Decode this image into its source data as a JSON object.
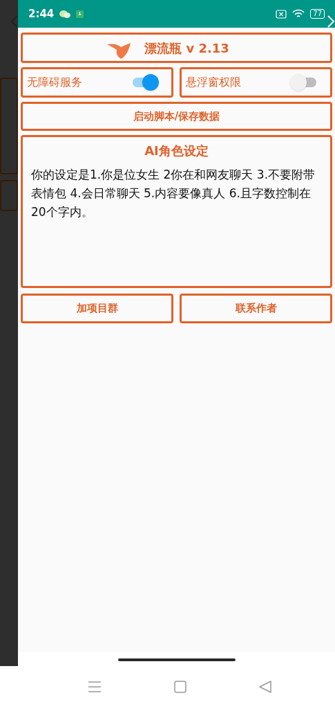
{
  "status_bar": {
    "time": "2:44",
    "battery": "77"
  },
  "title": "漂流瓶 v 2.13",
  "toggles": [
    {
      "label": "无障碍服务",
      "on": true
    },
    {
      "label": "悬浮窗权限",
      "on": false
    }
  ],
  "start_button": "启动脚本/保存数据",
  "ai_card": {
    "heading": "AI角色设定",
    "text": "你的设定是1.你是位女生 2你在和网友聊天 3.不要附带表情包 4.会日常聊天 5.内容要像真人 6.且字数控制在20个字内。"
  },
  "buttons": [
    "加项目群",
    "联系作者"
  ]
}
